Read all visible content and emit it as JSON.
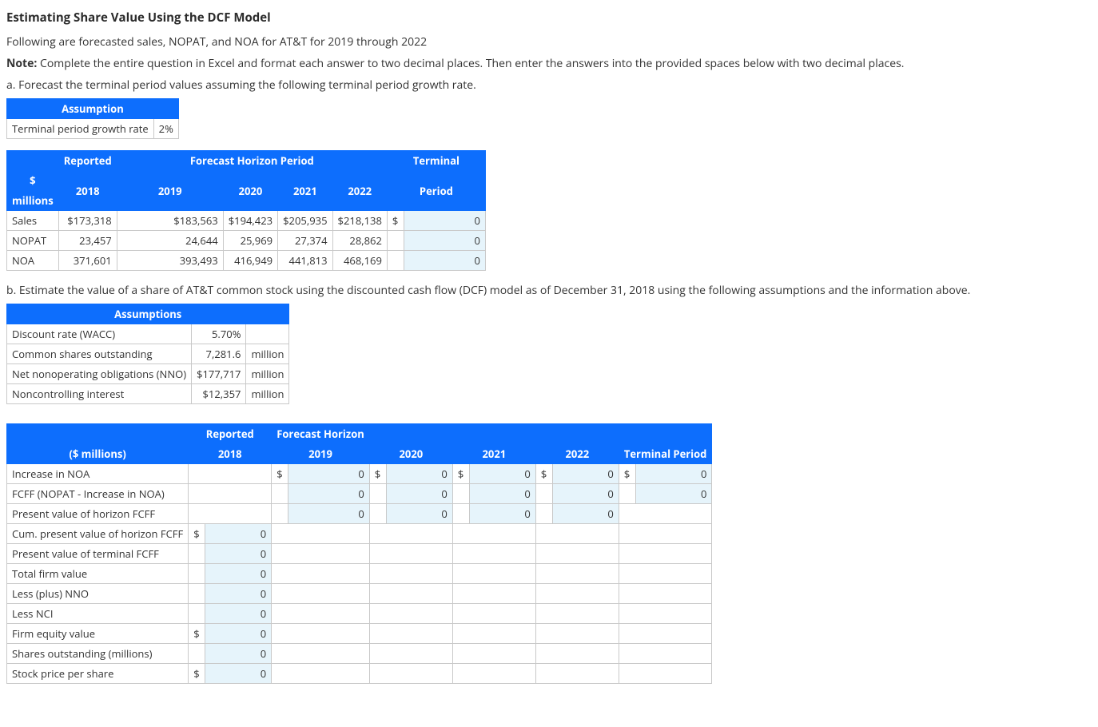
{
  "title": "Estimating Share Value Using the DCF Model",
  "intro1": "Following are forecasted sales, NOPAT, and NOA for AT&T for 2019 through 2022",
  "noteLabel": "Note:",
  "noteText": " Complete the entire question in Excel and format each answer to two decimal places. Then enter the answers into the provided spaces below with two decimal places.",
  "partA": "a. Forecast the terminal period values assuming the following terminal period growth rate.",
  "assumptionHdr": "Assumption",
  "assumptionRow": {
    "label": "Terminal period growth rate",
    "value": "2%"
  },
  "t1": {
    "topHdr": {
      "reported": "Reported",
      "horizon": "Forecast Horizon Period",
      "terminal": "Terminal"
    },
    "col0a": "$",
    "col0b": "millions",
    "years": {
      "y2018": "2018",
      "y2019": "2019",
      "y2020": "2020",
      "y2021": "2021",
      "y2022": "2022",
      "period": "Period"
    },
    "rows": {
      "sales": {
        "label": "Sales",
        "y2018": "$173,318",
        "y2019": "$183,563",
        "y2020": "$194,423",
        "y2021": "$205,935",
        "y2022": "$218,138",
        "dollar": "$",
        "term": "0"
      },
      "nopat": {
        "label": "NOPAT",
        "y2018": "23,457",
        "y2019": "24,644",
        "y2020": "25,969",
        "y2021": "27,374",
        "y2022": "28,862",
        "term": "0"
      },
      "noa": {
        "label": "NOA",
        "y2018": "371,601",
        "y2019": "393,493",
        "y2020": "416,949",
        "y2021": "441,813",
        "y2022": "468,169",
        "term": "0"
      }
    }
  },
  "partB": "b. Estimate the value of a share of AT&T common stock using the discounted cash flow (DCF) model as of December 31, 2018 using the following assumptions and the information above.",
  "assumptionsHdr": "Assumptions",
  "assumptions": {
    "r1": {
      "label": "Discount rate (WACC)",
      "val": "5.70%",
      "unit": ""
    },
    "r2": {
      "label": "Common shares outstanding",
      "val": "7,281.6",
      "unit": "million"
    },
    "r3": {
      "label": "Net nonoperating obligations (NNO)",
      "val": "$177,717",
      "unit": "million"
    },
    "r4": {
      "label": "Noncontrolling interest",
      "val": "$12,357",
      "unit": "million"
    }
  },
  "t3": {
    "hdr": {
      "col0": "($ millions)",
      "reported": "Reported",
      "forecast": "Forecast Horizon",
      "terminal": "Terminal Period",
      "y2018": "2018",
      "y2019": "2019",
      "y2020": "2020",
      "y2021": "2021",
      "y2022": "2022"
    },
    "rows": {
      "incNoa": {
        "label": "Increase in NOA"
      },
      "fcff": {
        "label": "FCFF (NOPAT - Increase in NOA)"
      },
      "pvHoriz": {
        "label": "Present value of horizon FCFF"
      },
      "cumPv": {
        "label": "Cum. present value of horizon FCFF"
      },
      "pvTerm": {
        "label": "Present value of terminal FCFF"
      },
      "totFirm": {
        "label": "Total firm value"
      },
      "lessNno": {
        "label": "Less (plus) NNO"
      },
      "lessNci": {
        "label": "Less NCI"
      },
      "equity": {
        "label": "Firm equity value"
      },
      "shares": {
        "label": "Shares outstanding (millions)"
      },
      "price": {
        "label": "Stock price per share"
      }
    },
    "zero": "0",
    "dollar": "$"
  }
}
